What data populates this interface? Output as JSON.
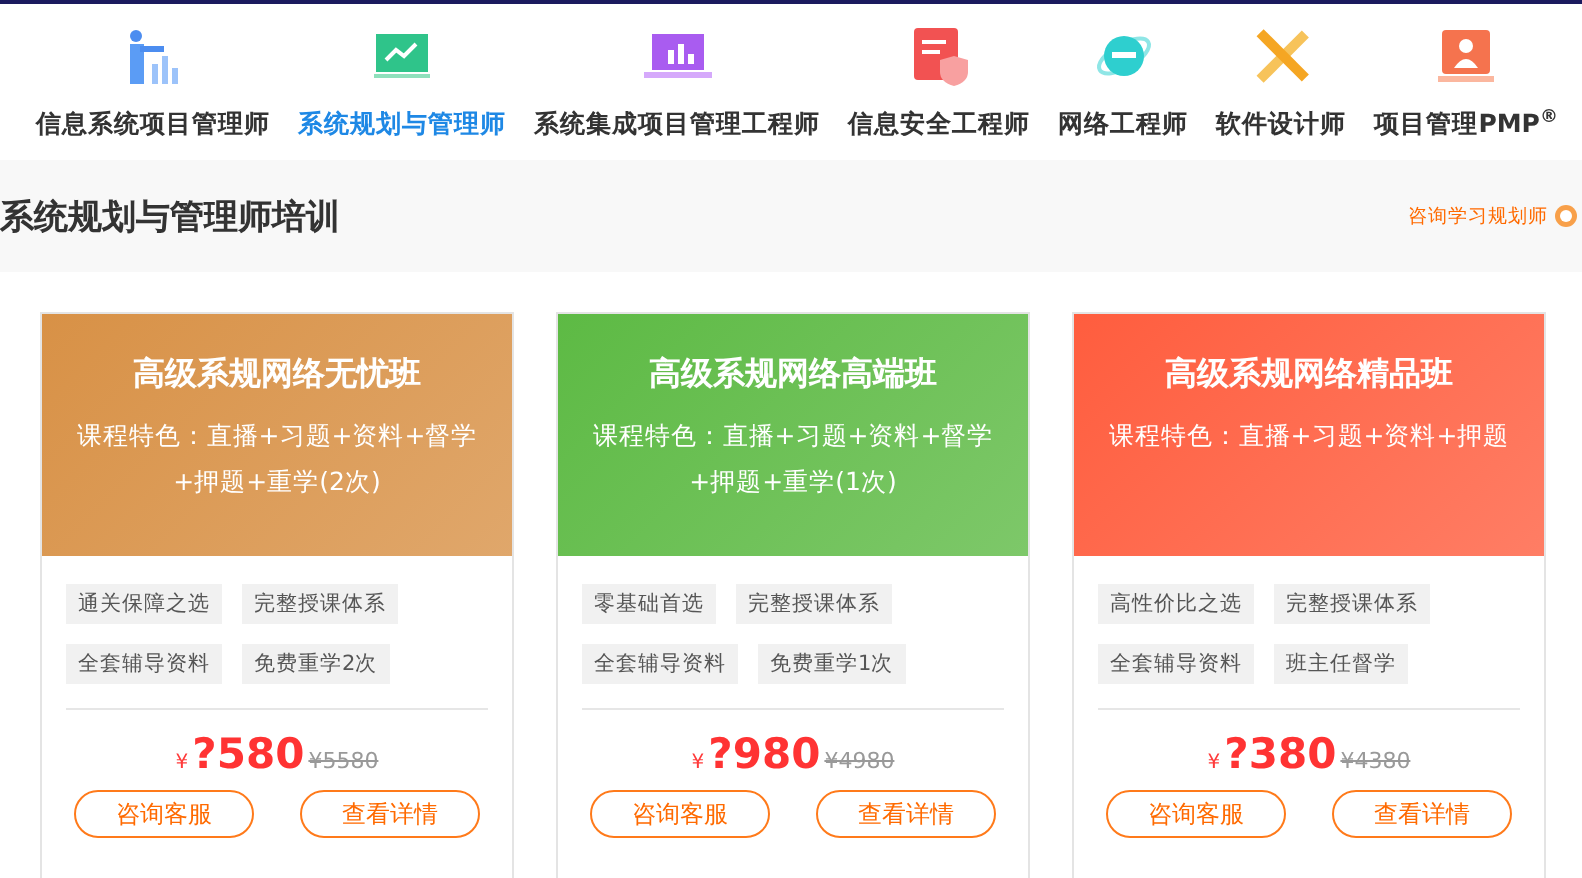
{
  "nav": [
    {
      "label": "信息系统项目管理师",
      "selected": false
    },
    {
      "label": "系统规划与管理师",
      "selected": true
    },
    {
      "label": "系统集成项目管理工程师",
      "selected": false
    },
    {
      "label": "信息安全工程师",
      "selected": false
    },
    {
      "label": "网络工程师",
      "selected": false
    },
    {
      "label": "软件设计师",
      "selected": false
    },
    {
      "label": "项目管理PMP$^{®}$",
      "selected": false
    }
  ],
  "section": {
    "title": "系统规划与管理师培训",
    "consult": "咨询学习规划师"
  },
  "cards": [
    {
      "title": "高级系规网络无忧班",
      "color": "#d89146",
      "features": "课程特色：直播+习题+资料+督学+押题+重学(2次)",
      "tags": [
        "通关保障之选",
        "完整授课体系",
        "全套辅导资料",
        "免费重学2次"
      ],
      "currency": "¥",
      "price": "?580",
      "old_price": "¥5580",
      "buttons": [
        "咨询客服",
        "查看详情"
      ]
    },
    {
      "title": "高级系规网络高端班",
      "color": "#5dba44",
      "features": "课程特色：直播+习题+资料+督学+押题+重学(1次)",
      "tags": [
        "零基础首选",
        "完整授课体系",
        "全套辅导资料",
        "免费重学1次"
      ],
      "currency": "¥",
      "price": "?980",
      "old_price": "¥4980",
      "buttons": [
        "咨询客服",
        "查看详情"
      ]
    },
    {
      "title": "高级系规网络精品班",
      "color": "#ff5d3e",
      "features": "课程特色：直播+习题+资料+押题",
      "tags": [
        "高性价比之选",
        "完整授课体系",
        "全套辅导资料",
        "班主任督学"
      ],
      "currency": "¥",
      "price": "?380",
      "old_price": "¥4380",
      "buttons": [
        "咨询客服",
        "查看详情"
      ]
    }
  ]
}
